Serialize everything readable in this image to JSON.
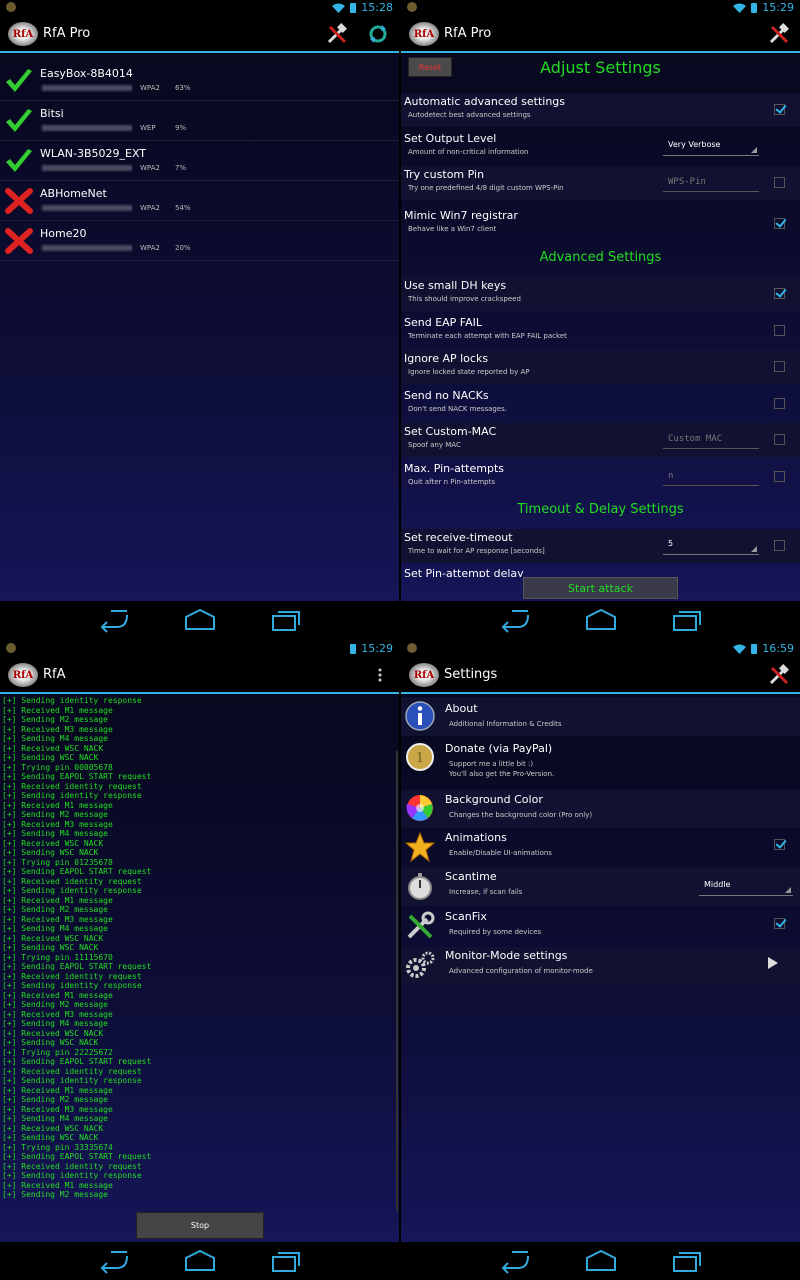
{
  "q1": {
    "status_time": "15:28",
    "app_title": "RfA Pro",
    "logo_text": "RfA",
    "networks": [
      {
        "ssid": "EasyBox-8B4014",
        "security": "WPA2",
        "signal": "63%",
        "status": "check"
      },
      {
        "ssid": "Bitsi",
        "security": "WEP",
        "signal": "9%",
        "status": "check"
      },
      {
        "ssid": "WLAN-3B5029_EXT",
        "security": "WPA2",
        "signal": "7%",
        "status": "check"
      },
      {
        "ssid": "ABHomeNet",
        "security": "WPA2",
        "signal": "54%",
        "status": "cross"
      },
      {
        "ssid": "Home20",
        "security": "WPA2",
        "signal": "20%",
        "status": "cross"
      }
    ]
  },
  "q2": {
    "status_time": "15:29",
    "app_title": "RfA Pro",
    "logo_text": "RfA",
    "reset_label": "Reset",
    "header_adjust": "Adjust Settings",
    "header_advanced": "Advanced Settings",
    "header_timeout": "Timeout & Delay Settings",
    "settings": [
      {
        "title": "Automatic advanced settings",
        "sub": "Autodetect best advanced settings",
        "checked": true
      },
      {
        "title": "Set Output Level",
        "sub": "Amount of non-critical information",
        "value": "Very Verbose"
      },
      {
        "title": "Try custom Pin",
        "sub": "Try one predefined 4/8 digit custom WPS-Pin",
        "placeholder": "WPS-Pin",
        "checked": false
      },
      {
        "title": "Mimic Win7 registrar",
        "sub": "Behave like a Win7 client",
        "checked": true
      },
      {
        "title": "Use small DH keys",
        "sub": "This should improve crackspeed",
        "checked": true
      },
      {
        "title": "Send EAP FAIL",
        "sub": "Terminate each attempt with EAP FAIL packet",
        "checked": false
      },
      {
        "title": "Ignore AP locks",
        "sub": "Ignore locked state reported by AP",
        "checked": false
      },
      {
        "title": "Send no NACKs",
        "sub": "Don't send NACK messages.",
        "checked": false
      },
      {
        "title": "Set Custom-MAC",
        "sub": "Spoof any MAC",
        "placeholder": "Custom MAC",
        "checked": false
      },
      {
        "title": "Max. Pin-attempts",
        "sub": "Quit after n Pin-attempts",
        "placeholder": "n",
        "checked": false
      },
      {
        "title": "Set receive-timeout",
        "sub": "Time to wait for AP response [seconds]",
        "value": "5",
        "checked": false
      },
      {
        "title": "Set Pin-attempt delay"
      }
    ],
    "start_label": "Start attack"
  },
  "q3": {
    "status_time": "15:29",
    "app_title": "RfA",
    "logo_text": "RfA",
    "log_lines": [
      "[+] Sending identity response",
      "[+] Received M1 message",
      "[+] Sending M2 message",
      "[+] Received M3 message",
      "[+] Sending M4 message",
      "[+] Received WSC NACK",
      "[+] Sending WSC NACK",
      "[+] Trying pin 00005678",
      "[+] Sending EAPOL START request",
      "[+] Received identity request",
      "[+] Sending identity response",
      "[+] Received M1 message",
      "[+] Sending M2 message",
      "[+] Received M3 message",
      "[+] Sending M4 message",
      "[+] Received WSC NACK",
      "[+] Sending WSC NACK",
      "[+] Trying pin 01235678",
      "[+] Sending EAPOL START request",
      "[+] Received identity request",
      "[+] Sending identity response",
      "[+] Received M1 message",
      "[+] Sending M2 message",
      "[+] Received M3 message",
      "[+] Sending M4 message",
      "[+] Received WSC NACK",
      "[+] Sending WSC NACK",
      "[+] Trying pin 11115670",
      "[+] Sending EAPOL START request",
      "[+] Received identity request",
      "[+] Sending identity response",
      "[+] Received M1 message",
      "[+] Sending M2 message",
      "[+] Received M3 message",
      "[+] Sending M4 message",
      "[+] Received WSC NACK",
      "[+] Sending WSC NACK",
      "[+] Trying pin 22225672",
      "[+] Sending EAPOL START request",
      "[+] Received identity request",
      "[+] Sending identity response",
      "[+] Received M1 message",
      "[+] Sending M2 message",
      "[+] Received M3 message",
      "[+] Sending M4 message",
      "[+] Received WSC NACK",
      "[+] Sending WSC NACK",
      "[+] Trying pin 33335674",
      "[+] Sending EAPOL START request",
      "[+] Received identity request",
      "[+] Sending identity response",
      "[+] Received M1 message",
      "[+] Sending M2 message"
    ],
    "stop_label": "Stop"
  },
  "q4": {
    "status_time": "16:59",
    "app_title": "Settings",
    "logo_text": "RfA",
    "items": [
      {
        "title": "About",
        "sub": "Additional Information & Credits",
        "icon": "info-icon"
      },
      {
        "title": "Donate (via PayPal)",
        "sub": "Support me a little bit :)",
        "sub2": "You'll also get the Pro-Version.",
        "icon": "coin-icon"
      },
      {
        "title": "Background Color",
        "sub": "Changes the background color (Pro only)",
        "icon": "color-wheel-icon"
      },
      {
        "title": "Animations",
        "sub": "Enable/Disable UI-animations",
        "icon": "star-icon",
        "checked": true
      },
      {
        "title": "Scantime",
        "sub": "Increase, if scan fails",
        "icon": "stopwatch-icon",
        "value": "Middle"
      },
      {
        "title": "ScanFix",
        "sub": "Required by some devices",
        "icon": "tools-icon",
        "checked": true
      },
      {
        "title": "Monitor-Mode settings",
        "sub": "Advanced configuration of monitor-mode",
        "icon": "gears-icon"
      }
    ]
  },
  "colors": {
    "accent": "#33b5e5",
    "green": "#22dd22",
    "reset_red": "#ee3333"
  }
}
